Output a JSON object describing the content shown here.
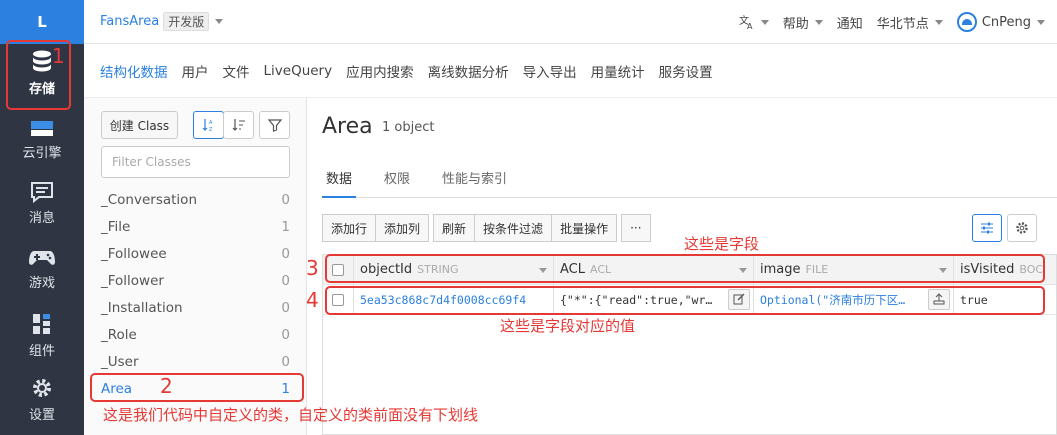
{
  "rail": {
    "logo": "L",
    "items": [
      {
        "label": "存储",
        "icon": "database-icon"
      },
      {
        "label": "云引擎",
        "icon": "cloud-engine-icon"
      },
      {
        "label": "消息",
        "icon": "message-icon"
      },
      {
        "label": "游戏",
        "icon": "gamepad-icon"
      },
      {
        "label": "组件",
        "icon": "components-icon"
      },
      {
        "label": "设置",
        "icon": "gear-icon"
      }
    ]
  },
  "topbar": {
    "app_name": "FansArea",
    "edition": "开发版",
    "lang_icon": "translate-icon",
    "help": "帮助",
    "notify": "通知",
    "region": "华北节点",
    "user": "CnPeng"
  },
  "nav": [
    "结构化数据",
    "用户",
    "文件",
    "LiveQuery",
    "应用内搜索",
    "离线数据分析",
    "导入导出",
    "用量统计",
    "服务设置"
  ],
  "sidebar": {
    "create_class": "创建 Class",
    "filter_placeholder": "Filter Classes",
    "classes": [
      {
        "name": "_Conversation",
        "count": "0"
      },
      {
        "name": "_File",
        "count": "1"
      },
      {
        "name": "_Followee",
        "count": "0"
      },
      {
        "name": "_Follower",
        "count": "0"
      },
      {
        "name": "_Installation",
        "count": "0"
      },
      {
        "name": "_Role",
        "count": "0"
      },
      {
        "name": "_User",
        "count": "0"
      },
      {
        "name": "Area",
        "count": "1"
      }
    ]
  },
  "main": {
    "title": "Area",
    "count": "1 object",
    "tabs": [
      "数据",
      "权限",
      "性能与索引"
    ],
    "toolbar": [
      "添加行",
      "添加列",
      "刷新",
      "按条件过滤",
      "批量操作",
      "···"
    ],
    "columns": [
      {
        "name": "objectId",
        "type": "STRING"
      },
      {
        "name": "ACL",
        "type": "ACL"
      },
      {
        "name": "image",
        "type": "FILE"
      },
      {
        "name": "isVisited",
        "type": "BOC"
      }
    ],
    "row": {
      "objectId": "5ea53c868c7d4f0008cc69f4",
      "acl": "{\"*\":{\"read\":true,\"wr…",
      "image": "Optional(\"济南市历下区…",
      "isVisited": "true"
    }
  },
  "annotations": {
    "n1": "1",
    "n2": "2",
    "n3": "3",
    "n4": "4",
    "fields": "这些是字段",
    "values": "这些是字段对应的值",
    "custom_class": "这是我们代码中自定义的类，自定义的类前面没有下划线"
  },
  "colors": {
    "accent": "#2b80e0",
    "rail": "#2f3543",
    "annotation": "#e53935"
  }
}
